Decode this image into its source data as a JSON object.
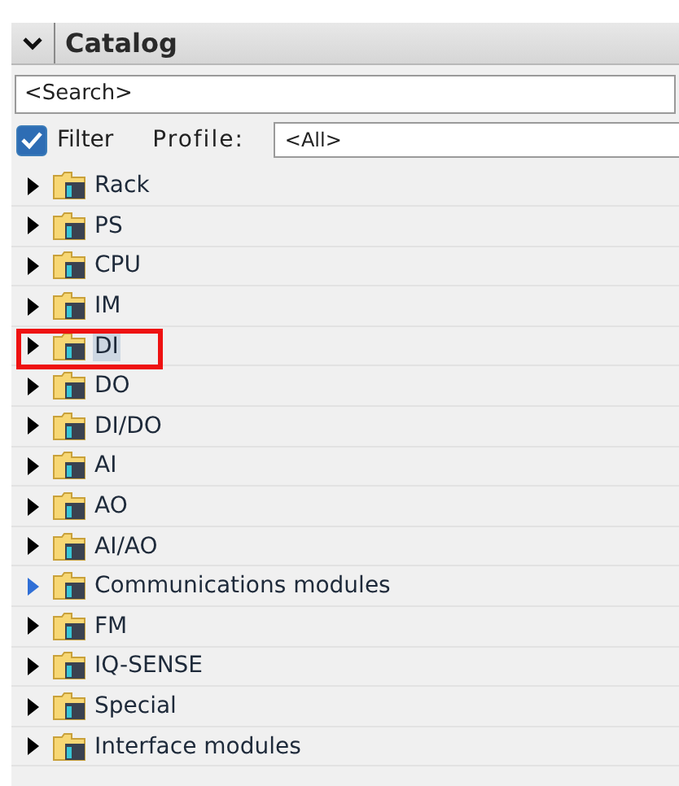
{
  "panel": {
    "title": "Catalog",
    "expanded": true
  },
  "search": {
    "placeholder": "<Search>"
  },
  "filter": {
    "label": "Filter",
    "checked": true
  },
  "profile": {
    "label": "Profile:",
    "value": "<All>"
  },
  "tree": [
    {
      "label": "Rack",
      "selected": false,
      "hovered": false,
      "marked": false
    },
    {
      "label": "PS",
      "selected": false,
      "hovered": false,
      "marked": false
    },
    {
      "label": "CPU",
      "selected": false,
      "hovered": false,
      "marked": false
    },
    {
      "label": "IM",
      "selected": false,
      "hovered": false,
      "marked": false
    },
    {
      "label": "DI",
      "selected": true,
      "hovered": false,
      "marked": true
    },
    {
      "label": "DO",
      "selected": false,
      "hovered": false,
      "marked": false
    },
    {
      "label": "DI/DO",
      "selected": false,
      "hovered": false,
      "marked": false
    },
    {
      "label": "AI",
      "selected": false,
      "hovered": false,
      "marked": false
    },
    {
      "label": "AO",
      "selected": false,
      "hovered": false,
      "marked": false
    },
    {
      "label": "AI/AO",
      "selected": false,
      "hovered": false,
      "marked": false
    },
    {
      "label": "Communications modules",
      "selected": false,
      "hovered": true,
      "marked": false
    },
    {
      "label": "FM",
      "selected": false,
      "hovered": false,
      "marked": false
    },
    {
      "label": "IQ-SENSE",
      "selected": false,
      "hovered": false,
      "marked": false
    },
    {
      "label": "Special",
      "selected": false,
      "hovered": false,
      "marked": false
    },
    {
      "label": "Interface modules",
      "selected": false,
      "hovered": false,
      "marked": false
    }
  ]
}
